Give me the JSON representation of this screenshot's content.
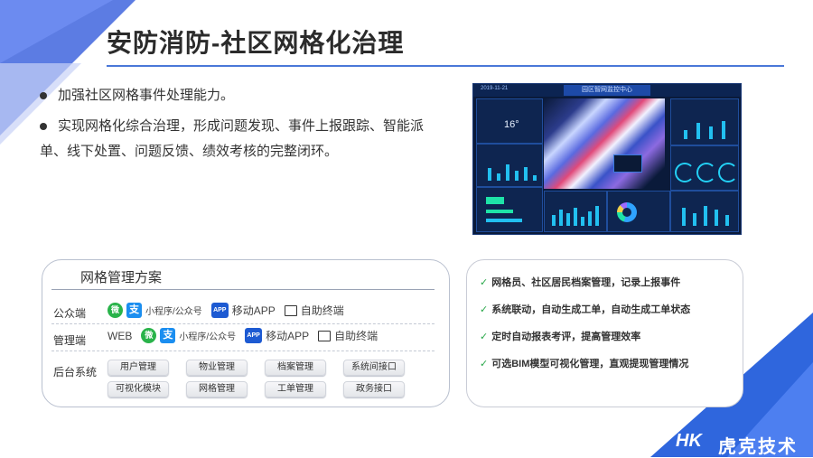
{
  "title": "安防消防-社区网格化治理",
  "bullets": [
    "加强社区网格事件处理能力。",
    "实现网格化综合治理，形成问题发现、事件上报跟踪、智能派",
    "单、线下处置、问题反馈、绩效考核的完整闭环。"
  ],
  "dashboard": {
    "header": "园区智网监控中心",
    "temperature": "16°",
    "time": "2019-11-21"
  },
  "plan": {
    "title": "网格管理方案",
    "public": {
      "label": "公众端",
      "wx_icon": "微",
      "zfb_icon": "支",
      "miniprogram": "小程序/公众号",
      "app_icon": "APP",
      "app_label": "移动APP",
      "terminal": "自助终端"
    },
    "manage": {
      "label": "管理端",
      "web": "WEB",
      "miniprogram": "小程序/公众号",
      "app_icon": "APP",
      "app_label": "移动APP",
      "terminal": "自助终端"
    },
    "backend": {
      "label": "后台系统",
      "modules": [
        "用户管理",
        "物业管理",
        "档案管理",
        "系统间接口",
        "可视化模块",
        "网格管理",
        "工单管理",
        "政务接口"
      ]
    }
  },
  "features": [
    "网格员、社区居民档案管理，记录上报事件",
    "系统联动，自动生成工单，自动生成工单状态",
    "定时自动报表考评，提高管理效率",
    "可选BIM模型可视化管理，直观提现管理情况"
  ],
  "logo": {
    "mark": "HK",
    "name": "虎克技术"
  },
  "colors": {
    "accent": "#4a78d8",
    "check": "#2aa84a"
  }
}
